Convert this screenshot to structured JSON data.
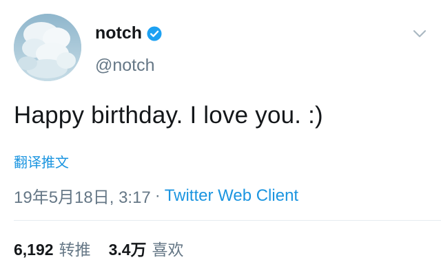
{
  "author": {
    "display_name": "notch",
    "handle": "@notch",
    "verified_icon": "verified-badge-icon",
    "avatar_icon": "avatar-cloud-image"
  },
  "tweet": {
    "text": "Happy birthday. I love you. :)",
    "translate_label": "翻译推文"
  },
  "meta": {
    "timestamp": "19年5月18日, 3:17",
    "separator": "·",
    "client": "Twitter Web Client"
  },
  "stats": {
    "retweets_count": "6,192",
    "retweets_label": "转推",
    "likes_count": "3.4万",
    "likes_label": "喜欢"
  },
  "colors": {
    "link_blue": "#1b95e0",
    "secondary_text": "#657786",
    "primary_text": "#14171a",
    "divider": "#e6ecf0"
  }
}
